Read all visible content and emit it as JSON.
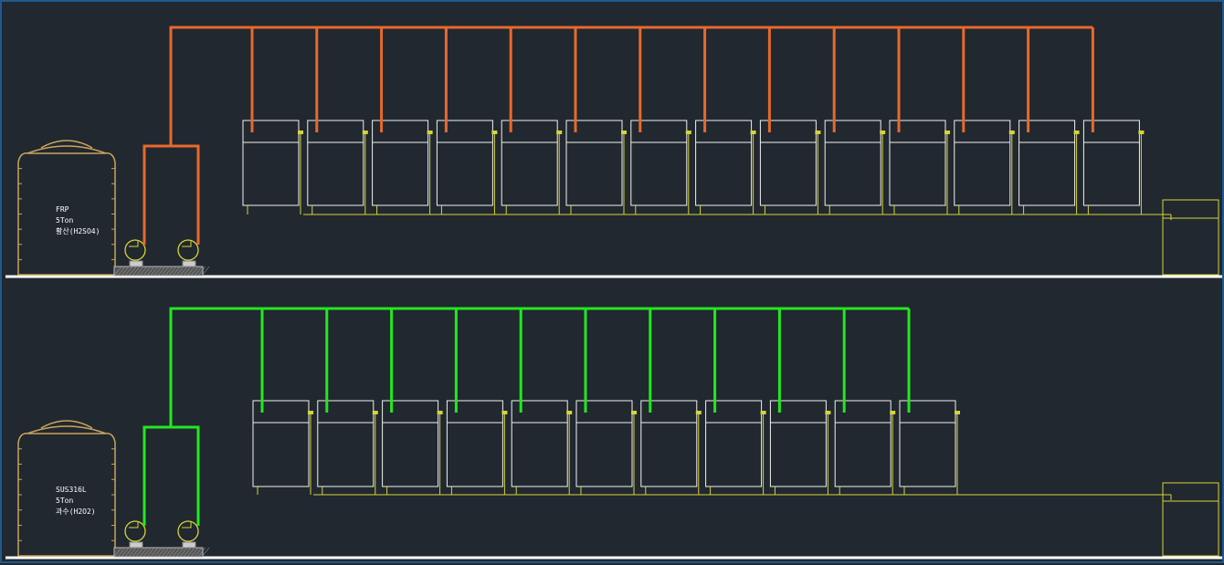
{
  "colors": {
    "background": "#212830",
    "frame": "#1f5a8c",
    "upper_pipe": "#e8692c",
    "lower_pipe": "#22e81f",
    "tank_outline": "#c9a45a",
    "drain_line": "#d8d338",
    "equipment_outline": "#f2f2f2",
    "floor_line": "#ffffff"
  },
  "systems": [
    {
      "id": "upper",
      "tank_label": [
        "FRP",
        "5Ton",
        "황산(H2SO4)"
      ],
      "pipe_color_key": "upper_pipe",
      "unit_count": 14
    },
    {
      "id": "lower",
      "tank_label": [
        "SUS316L",
        "5Ton",
        "과수(H2O2)"
      ],
      "pipe_color_key": "lower_pipe",
      "unit_count": 11
    }
  ],
  "icons": [
    "pump-icon",
    "storage-tank-icon",
    "drain-tank-icon"
  ]
}
